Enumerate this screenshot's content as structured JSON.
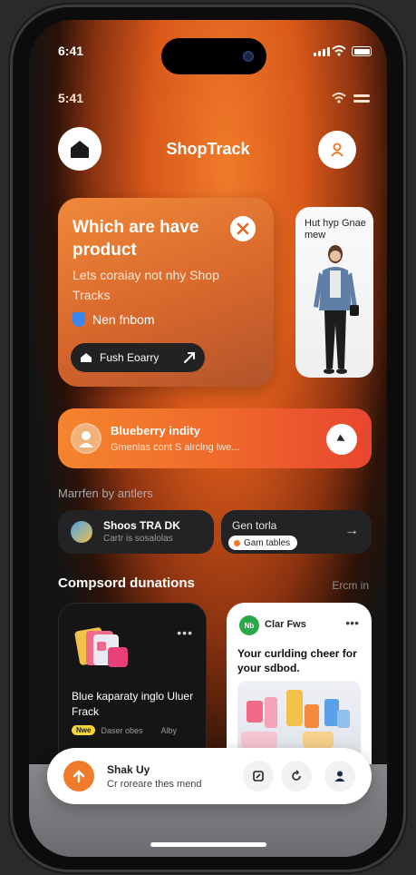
{
  "status_bar": {
    "time_top": "6:41",
    "time_second": "5:41"
  },
  "header": {
    "title": "ShopTrack"
  },
  "hero": {
    "title": "Which are have product",
    "body": "Lets coraiay not nhy Shop Tracks",
    "tag": "Nen fnbom",
    "cta": "Fush Eoarry"
  },
  "side_card": {
    "caption": "Hut hyp Gnae mew"
  },
  "banner": {
    "title": "Blueberry indity",
    "subtitle": "Gmenlas cont S alrclng lwe..."
  },
  "section_label": "Marrfen by antlers",
  "pill_left": {
    "title": "Shoos TRA DK",
    "subtitle": "Cartr is sosalolas"
  },
  "pill_right": {
    "title": "Gen torla",
    "chip": "Gam tables",
    "arrow": "→"
  },
  "list_section": {
    "title": "Compsord dunations",
    "see_all": "Ercm in"
  },
  "card_dark": {
    "title": "Blue kaparaty inglo Uluer Frack",
    "badge": "Nwe",
    "meta1": "Daser obes",
    "meta2": "Alby",
    "more": "•••"
  },
  "card_light": {
    "badge": "Nb",
    "name": "Clar Fws",
    "more": "•••",
    "title": "Your curlding cheer for your sdbod."
  },
  "bottom_bar": {
    "title": "Shak Uy",
    "subtitle": "Cr roreare thes mend"
  },
  "colors": {
    "accent": "#f07b2d",
    "banner_end": "#e8462f",
    "shield": "#3c86f0",
    "badge_green": "#2aa84a"
  },
  "icons": [
    "home-logo-icon",
    "user-icon",
    "close-icon",
    "shield-icon",
    "play-icon",
    "send-icon",
    "arrow-up-icon",
    "note-icon",
    "refresh-icon",
    "account-icon"
  ]
}
